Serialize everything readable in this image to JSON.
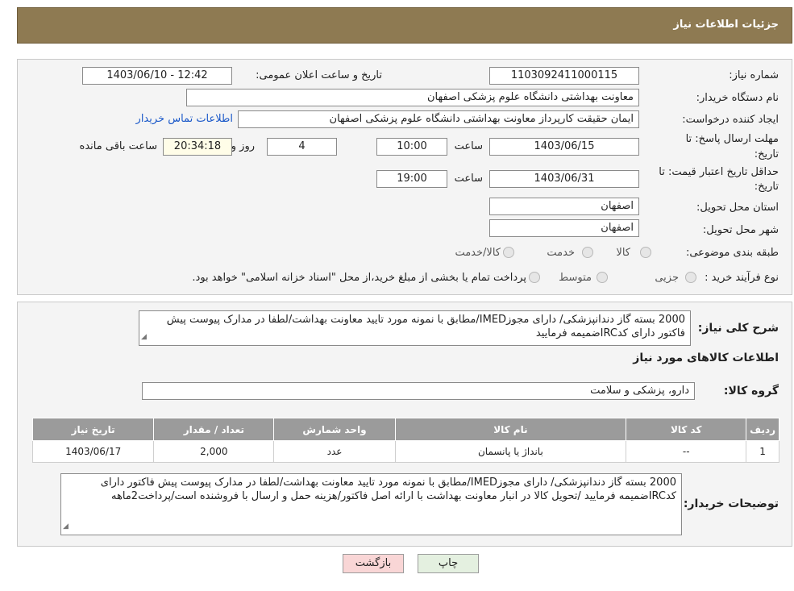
{
  "header": {
    "title": "جزئیات اطلاعات نیاز"
  },
  "form": {
    "need_number_label": "شماره نیاز:",
    "need_number": "1103092411000115",
    "announce_label": "تاریخ و ساعت اعلان عمومی:",
    "announce_value": "1403/06/10 - 12:42",
    "buyer_org_label": "نام دستگاه خریدار:",
    "buyer_org": "معاونت بهداشتی دانشگاه علوم پزشکی اصفهان",
    "creator_label": "ایجاد کننده درخواست:",
    "creator": "ایمان حقیقت کارپرداز معاونت بهداشتی دانشگاه علوم پزشکی اصفهان",
    "contact_link": "اطلاعات تماس خریدار",
    "deadline_label_1": "مهلت ارسال پاسخ: تا",
    "deadline_label_2": "تاریخ:",
    "deadline_date": "1403/06/15",
    "time_label": "ساعت",
    "deadline_time": "10:00",
    "days_value": "4",
    "days_label": "روز و",
    "remaining_time": "20:34:18",
    "remaining_label": "ساعت باقی مانده",
    "price_valid_label_1": "حداقل تاریخ اعتبار قیمت: تا",
    "price_valid_label_2": "تاریخ:",
    "price_valid_date": "1403/06/31",
    "price_valid_time": "19:00",
    "province_label": "استان محل تحویل:",
    "province": "اصفهان",
    "city_label": "شهر محل تحویل:",
    "city": "اصفهان",
    "category_label": "طبقه بندی موضوعی:",
    "category_options": [
      "کالا",
      "خدمت",
      "کالا/خدمت"
    ],
    "process_label": "نوع فرآیند خرید :",
    "process_options": [
      "جزیی",
      "متوسط"
    ],
    "process_note": "پرداخت تمام یا بخشی از مبلغ خرید،از محل \"اسناد خزانه اسلامی\" خواهد بود."
  },
  "details": {
    "summary_label": "شرح کلی نیاز:",
    "summary": "2000 بسته گاز دندانپزشکی/ دارای مجوزIMED/مطابق با نمونه مورد تایید معاونت بهداشت/لطفا در مدارک پیوست پیش فاکتور دارای کدIRCضمیمه فرمایید",
    "goods_info_title": "اطلاعات کالاهای مورد نیاز",
    "goods_group_label": "گروه کالا:",
    "goods_group": "دارو، پزشکی و سلامت",
    "table": {
      "headers": [
        "ردیف",
        "کد کالا",
        "نام کالا",
        "واحد شمارش",
        "تعداد / مقدار",
        "تاریخ نیاز"
      ],
      "rows": [
        [
          "1",
          "--",
          "بانداژ یا پانسمان",
          "عدد",
          "2,000",
          "1403/06/17"
        ]
      ]
    },
    "buyer_notes_label": "توضیحات خریدار:",
    "buyer_notes": "2000 بسته گاز دندانپزشکی/ دارای مجوزIMED/مطابق با نمونه مورد تایید معاونت بهداشت/لطفا در مدارک پیوست پیش فاکتور دارای کدIRCضمیمه فرمایید /تحویل کالا در انبار معاونت بهداشت با ارائه اصل فاکتور/هزینه حمل و ارسال با فروشنده است/پرداخت2ماهه"
  },
  "buttons": {
    "print": "چاپ",
    "back": "بازگشت"
  },
  "colors": {
    "header_bg": "#8e7a52",
    "link": "#1a58c9",
    "table_header": "#9b9b9b",
    "back_btn": "#f9d6d6",
    "print_btn": "#e4f0e0"
  }
}
